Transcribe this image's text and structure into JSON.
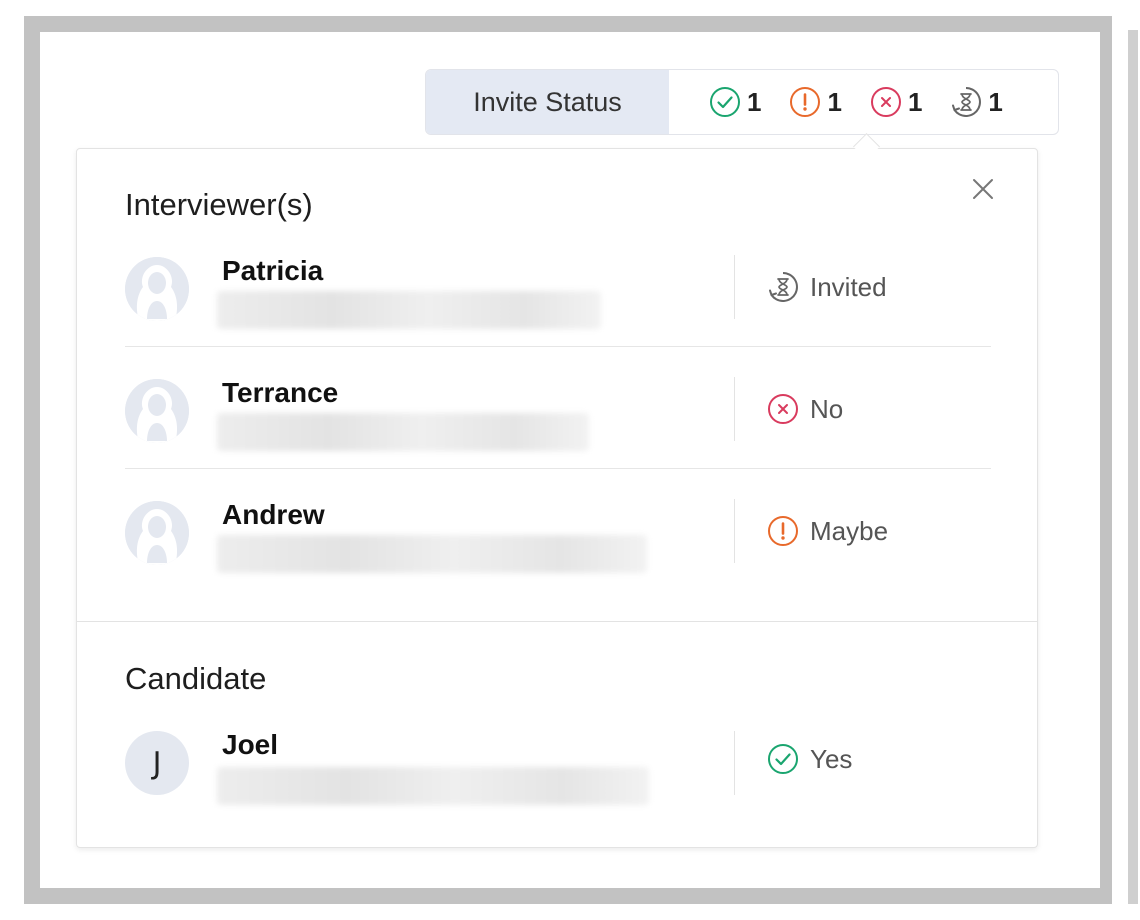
{
  "status_bar": {
    "label": "Invite Status",
    "counts": [
      {
        "kind": "yes",
        "icon": "check-circle-icon",
        "color": "#1aa56f",
        "value": "1"
      },
      {
        "kind": "maybe",
        "icon": "exclamation-circle-icon",
        "color": "#e8692b",
        "value": "1"
      },
      {
        "kind": "no",
        "icon": "x-circle-icon",
        "color": "#d93b5e",
        "value": "1"
      },
      {
        "kind": "invited",
        "icon": "hourglass-icon",
        "color": "#666666",
        "value": "1"
      }
    ]
  },
  "popover": {
    "close_icon": "close-icon",
    "interviewers_title": "Interviewer(s)",
    "interviewers": [
      {
        "name": "Patricia",
        "avatar_icon": "person-silhouette-icon",
        "status_icon": "hourglass-icon",
        "status": "Invited"
      },
      {
        "name": "Terrance",
        "avatar_icon": "person-silhouette-icon",
        "status_icon": "x-circle-icon",
        "status": "No"
      },
      {
        "name": "Andrew",
        "avatar_icon": "person-silhouette-icon",
        "status_icon": "exclamation-circle-icon",
        "status": "Maybe"
      }
    ],
    "candidate_title": "Candidate",
    "candidate": {
      "name": "Joel",
      "avatar_letter": "J",
      "status_icon": "check-circle-icon",
      "status": "Yes"
    }
  },
  "colors": {
    "yes": "#1aa56f",
    "maybe": "#e8692b",
    "no": "#d93b5e",
    "invited": "#666666",
    "label_bg": "#e4e9f3",
    "avatar_bg": "#e4e8f0"
  }
}
